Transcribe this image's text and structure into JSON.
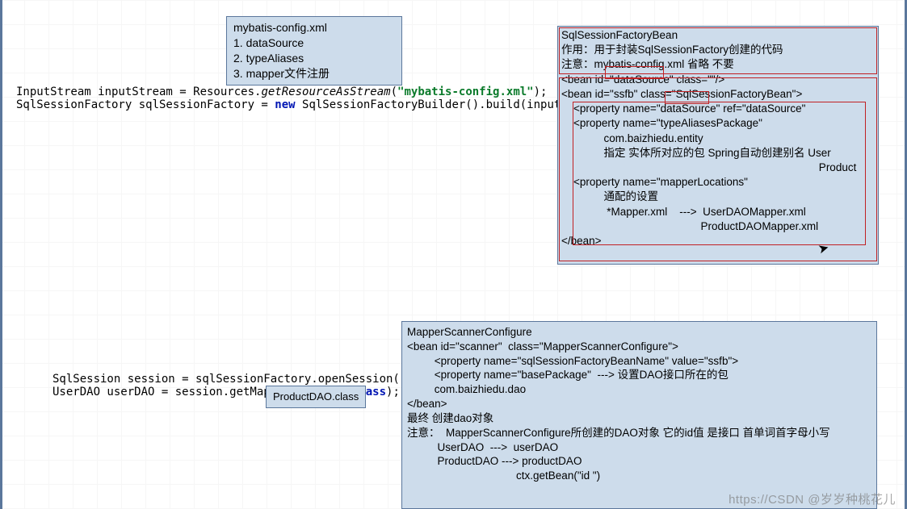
{
  "top_box": {
    "l1": "mybatis-config.xml",
    "l2": "1. dataSource",
    "l3": "2. typeAliases",
    "l4": "3. mapper文件注册"
  },
  "code1": {
    "pre1": "InputStream inputStream = Resources.",
    "m1": "getResourceAsStream",
    "open1": "(",
    "str1": "\"mybatis-config.xml\"",
    "close1": ");",
    "line2a": "SqlSessionFactory sqlSessionFactory = ",
    "kw_new": "new",
    "line2b": " SqlSessionFactoryBuilder().build(inputStream);"
  },
  "code2": {
    "l1a": "SqlSession session = sqlSessionFactory.openSession();",
    "l2a": "UserDAO userDAO = session.getMapper(UserDAO.",
    "kw_class": "class",
    "l2b": ");"
  },
  "product_box": "ProductDAO.class",
  "bigbox": {
    "l1": "SqlSessionFactoryBean",
    "l2": "作用：用于封装SqlSessionFactory创建的代码",
    "l3": "注意：mybatis-config.xml 省略 不要",
    "l4": "<bean id=\"dataSource\" class=\"\"/>",
    "blank1": " ",
    "l5": "<bean id=\"ssfb\" class=\"SqlSessionFactoryBean\">",
    "l6": "    <property name=\"dataSource\" ref=\"dataSource\"",
    "blank2": " ",
    "l7": "    <property name=\"typeAliasesPackage\"",
    "l8": "              com.baizhiedu.entity",
    "l9a": "              指定 实体所对应的包 Spring自动创建别名 User",
    "l9b": "                                                                                     Product",
    "blank3": " ",
    "l10": "    <property name=\"mapperLocations\"",
    "l11": "              通配的设置",
    "l12": "               *Mapper.xml    --->  UserDAOMapper.xml",
    "l13": "                                              ProductDAOMapper.xml",
    "blank4": " ",
    "l14": "</bean>"
  },
  "lowerbox": {
    "l1": "MapperScannerConfigure",
    "blank1": " ",
    "l2": "<bean id=\"scanner\"  class=\"MapperScannerConfigure\">",
    "l3": "         <property name=\"sqlSessionFactoryBeanName\" value=\"ssfb\">",
    "l4": "         <property name=\"basePackage\"  ---> 设置DAO接口所在的包",
    "blank2": " ",
    "l5": "         com.baizhiedu.dao",
    "blank3": " ",
    "l6": "</bean>",
    "l7": "最终  创建dao对象",
    "l8": "注意：  MapperScannerConfigure所创建的DAO对象 它的id值 是接口 首单词首字母小写",
    "l9": "          UserDAO  --->  userDAO",
    "l10": "          ProductDAO ---> productDAO",
    "blank4": " ",
    "l11": "                                    ctx.getBean(\"id \")"
  },
  "watermark": "https://CSDN @岁岁种桃花儿"
}
